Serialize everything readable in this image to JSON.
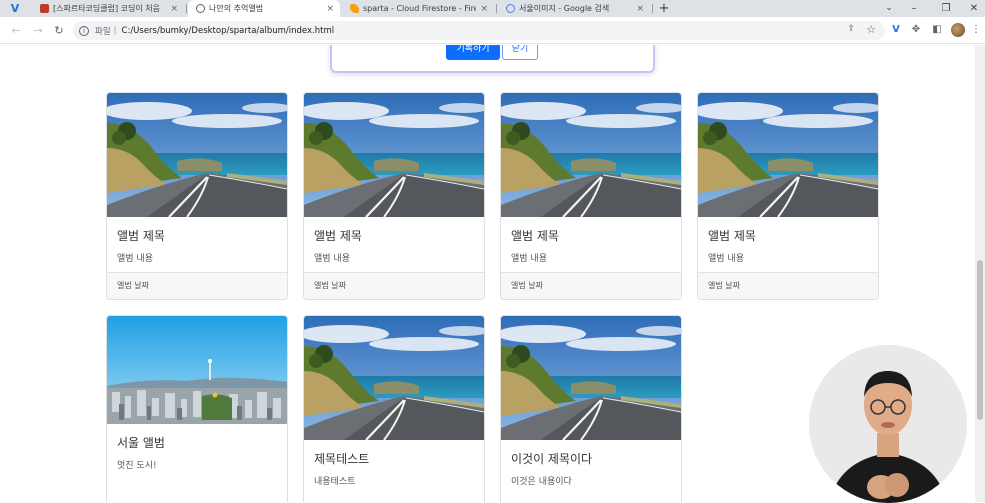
{
  "browser": {
    "tabs": [
      {
        "title": "[스파르타코딩클럽] 코딩이 처음",
        "close": "×",
        "favicon_color": "#c0392b",
        "active": false
      },
      {
        "title": "나만의 추억앨범",
        "close": "×",
        "favicon_color": "#5f6368",
        "active": true
      },
      {
        "title": "sparta - Cloud Firestore - Fireb",
        "close": "×",
        "favicon_color": "#f6a10a",
        "active": false
      },
      {
        "title": "서울이미지 - Google 검색",
        "close": "×",
        "favicon_color": "#4285f4",
        "active": false
      }
    ],
    "new_tab": "+",
    "address": {
      "scheme_label": "파일",
      "separator": "|",
      "url": "C:/Users/bumky/Desktop/sparta/album/index.html"
    }
  },
  "form": {
    "post_label": "기록하기",
    "close_label": "닫기"
  },
  "cards": [
    {
      "image": "road",
      "title": "앨범 제목",
      "text": "앨범 내용",
      "date": "앨범 날짜"
    },
    {
      "image": "road",
      "title": "앨범 제목",
      "text": "앨범 내용",
      "date": "앨범 날짜"
    },
    {
      "image": "road",
      "title": "앨범 제목",
      "text": "앨범 내용",
      "date": "앨범 날짜"
    },
    {
      "image": "road",
      "title": "앨범 제목",
      "text": "앨범 내용",
      "date": "앨범 날짜"
    },
    {
      "image": "city",
      "title": "서울 앨범",
      "text": "멋진 도시!"
    },
    {
      "image": "road",
      "title": "제목테스트",
      "text": "내용테스트"
    },
    {
      "image": "road",
      "title": "이것이 제목이다",
      "text": "이것은 내용이다"
    }
  ],
  "colors": {
    "primary": "#0d6efd",
    "card_border": "#dfdfdf",
    "form_border": "#c9c3f5"
  }
}
